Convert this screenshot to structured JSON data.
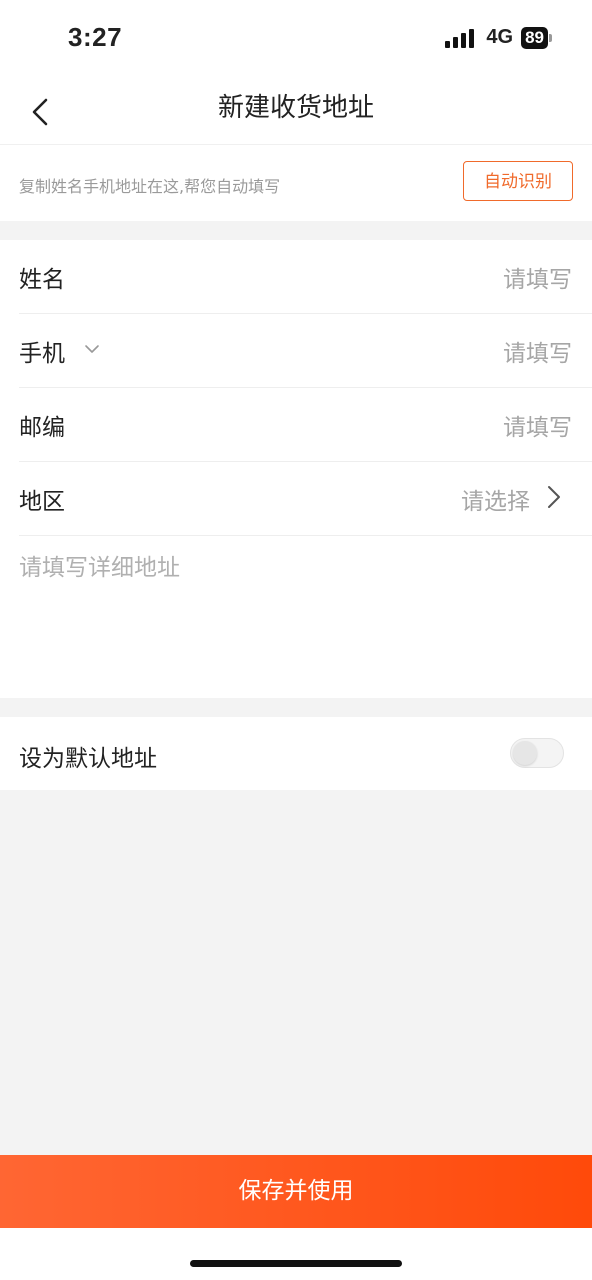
{
  "status_bar": {
    "time": "3:27",
    "network": "4G",
    "battery": "89"
  },
  "header": {
    "title": "新建收货地址"
  },
  "paste": {
    "hint": "复制姓名手机地址在这,帮您自动填写",
    "button": "自动识别"
  },
  "form": {
    "name": {
      "label": "姓名",
      "placeholder": "请填写"
    },
    "phone": {
      "label": "手机",
      "placeholder": "请填写"
    },
    "postcode": {
      "label": "邮编",
      "placeholder": "请填写"
    },
    "region": {
      "label": "地区",
      "placeholder": "请选择"
    },
    "detail_placeholder": "请填写详细地址"
  },
  "default_address": {
    "label": "设为默认地址",
    "enabled": false
  },
  "footer": {
    "save_button": "保存并使用"
  },
  "colors": {
    "accent": "#f06a2b",
    "save_start": "#ff6633",
    "save_end": "#ff4a0a"
  }
}
